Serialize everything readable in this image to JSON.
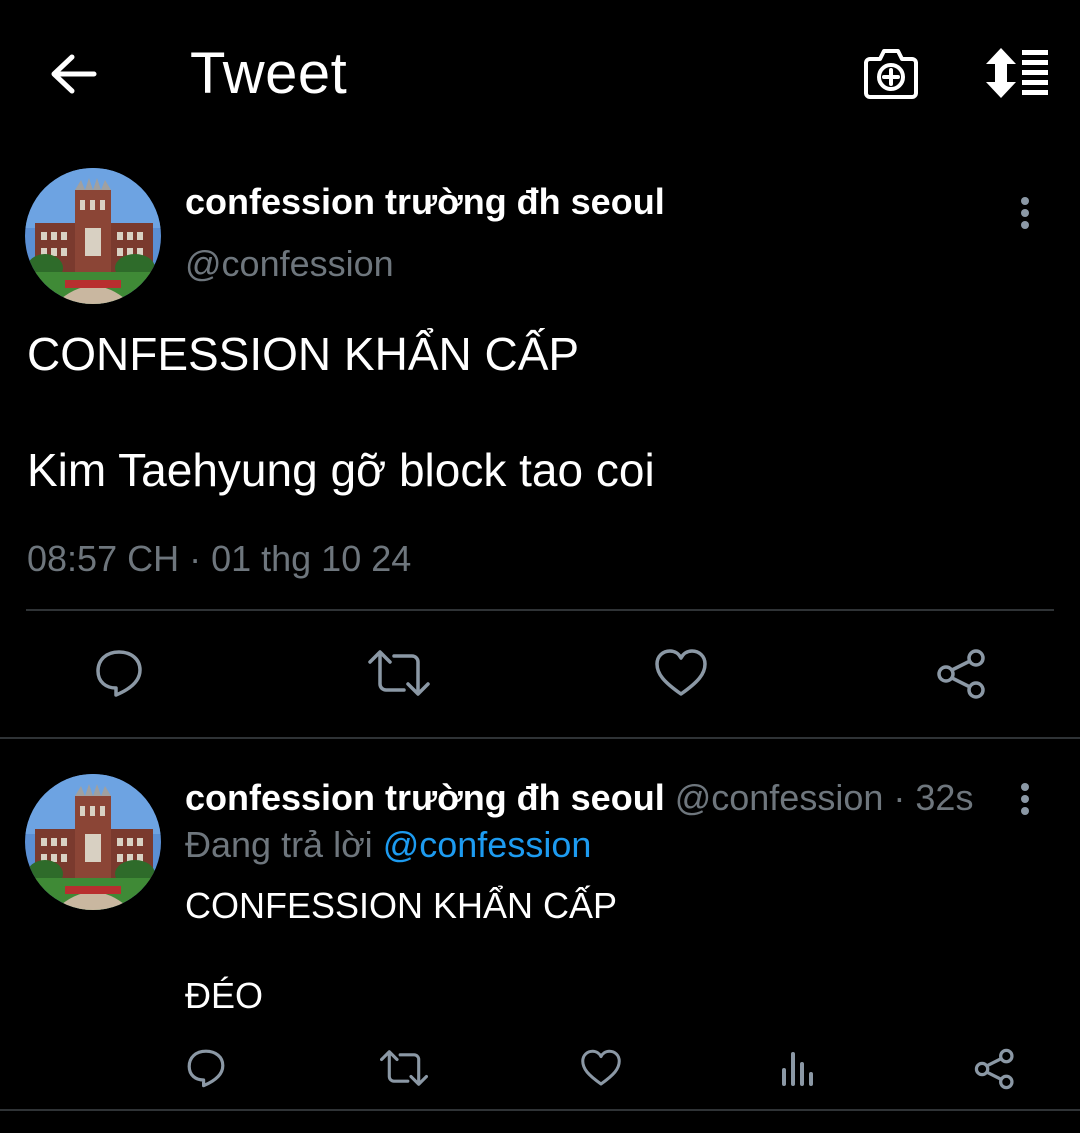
{
  "header": {
    "title": "Tweet",
    "back_icon": "arrow-left-icon",
    "camera_icon": "camera-plus-icon",
    "sort_icon": "sort-thread-icon"
  },
  "main_tweet": {
    "display_name": "confession trường đh seoul",
    "handle": "@confession",
    "text_line1": "CONFESSION KHẨN CẤP",
    "text_line2": "Kim Taehyung gỡ block tao coi",
    "timestamp": "08:57 CH · 01 thg 10 24",
    "actions": [
      "reply-icon",
      "retweet-icon",
      "like-icon",
      "share-icon"
    ]
  },
  "reply": {
    "display_name": "confession trường đh seoul",
    "handle": "@confession",
    "time_sep": "·",
    "time": "32s",
    "replying_prefix": "Đang trả lời",
    "replying_to": "@confession",
    "text": "CONFESSION KHẨN CẤP\n\nĐÉO",
    "actions": [
      "reply-icon",
      "retweet-icon",
      "like-icon",
      "views-icon",
      "share-icon"
    ]
  },
  "colors": {
    "background": "#000000",
    "text": "#ffffff",
    "muted": "#6e767d",
    "link": "#1d9bf0",
    "separator": "#2f3336"
  }
}
